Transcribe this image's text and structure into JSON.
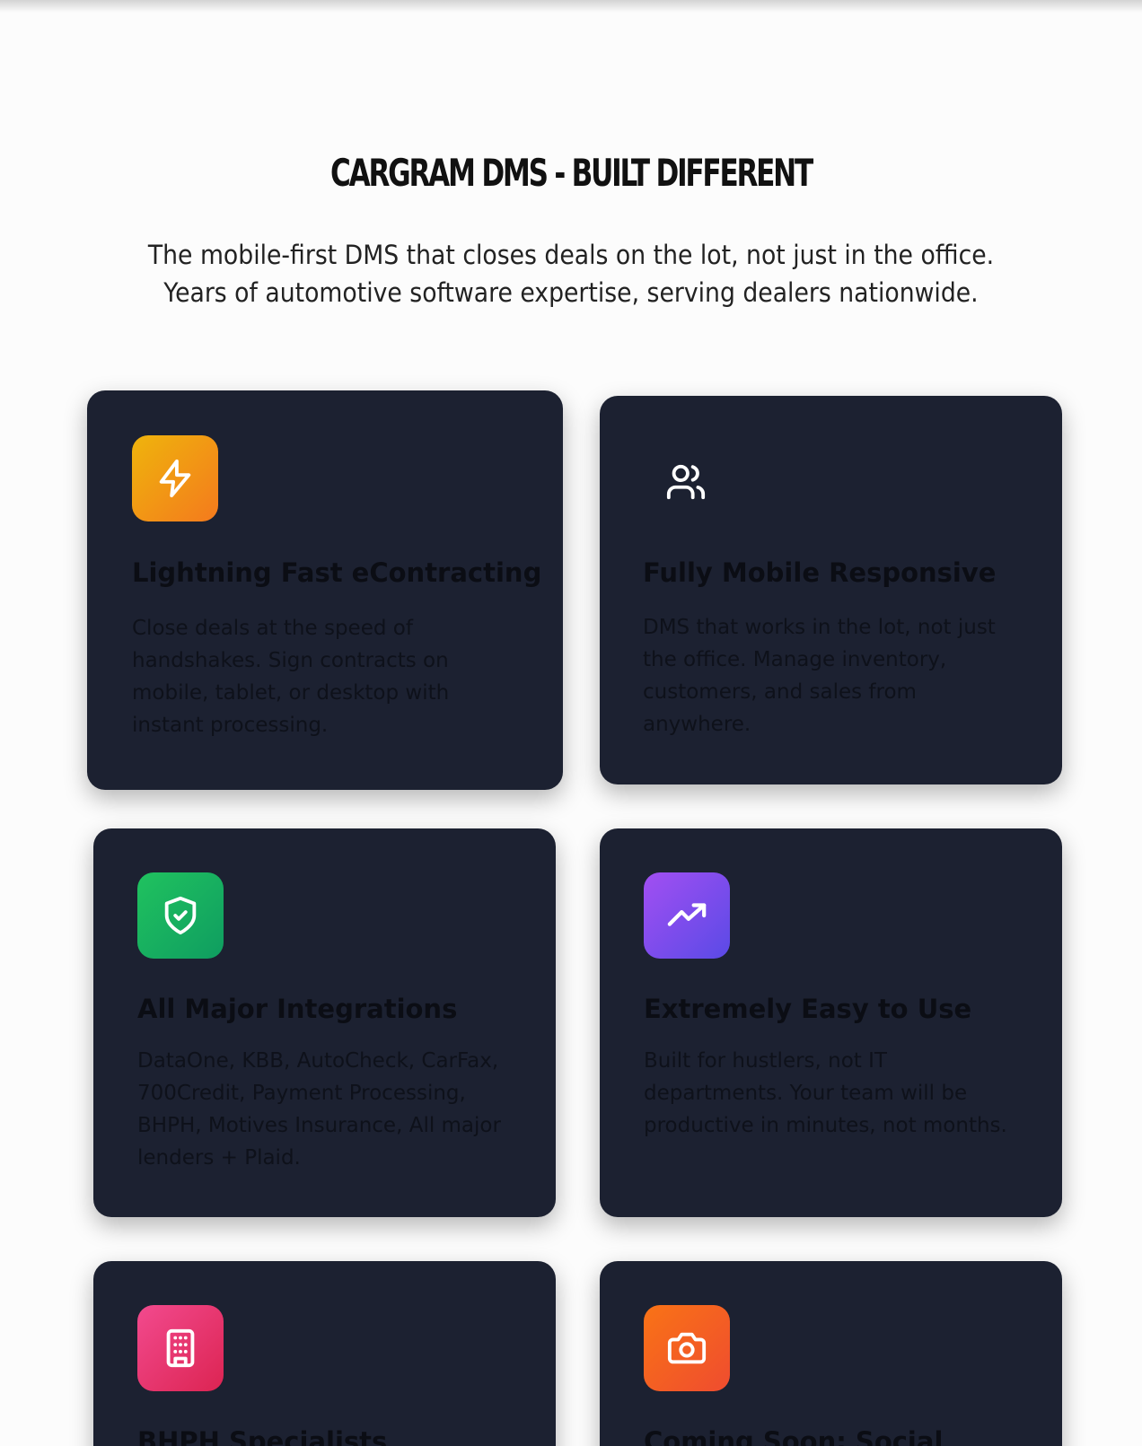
{
  "section": {
    "title": "CARGRAM DMS - BUILT DIFFERENT",
    "subtitle_line1": "The mobile-first DMS that closes deals on the lot, not just in the office.",
    "subtitle_line2": "Years of automotive software expertise, serving dealers nationwide."
  },
  "features": [
    {
      "icon": "lightning-icon",
      "title": "Lightning Fast eContracting",
      "text_lines": [
        "Close deals at the speed of",
        "handshakes. Sign contracts on",
        "mobile, tablet, or desktop with",
        "instant processing."
      ]
    },
    {
      "icon": "users-icon",
      "title": "Fully Mobile Responsive",
      "text_lines": [
        "DMS that works in the lot, not just",
        "the office. Manage inventory,",
        "customers, and sales from",
        "anywhere."
      ]
    },
    {
      "icon": "shield-check-icon",
      "title": "All Major Integrations",
      "text_lines": [
        "DataOne, KBB, AutoCheck, CarFax,",
        "700Credit, Payment Processing,",
        "BHPH, Motives Insurance, All major",
        "lenders + Plaid."
      ]
    },
    {
      "icon": "trending-up-icon",
      "title": "Extremely Easy to Use",
      "text_lines": [
        "Built for hustlers, not IT",
        "departments. Your team will be",
        "productive in minutes, not months."
      ]
    },
    {
      "icon": "building-icon",
      "title": "BHPH Specialists",
      "text_lines": []
    },
    {
      "icon": "camera-icon",
      "title": "Coming Soon: Social",
      "text_lines": []
    }
  ],
  "colors": {
    "card_background": "#1c2131",
    "page_background": "#fcfcfc",
    "lightning_gradient": [
      "#efb40c",
      "#f47a1d"
    ],
    "shield_gradient": [
      "#20c25f",
      "#0f9d60"
    ],
    "trending_gradient": [
      "#a24ff2",
      "#5a4ae6"
    ],
    "building_gradient": [
      "#f24a8e",
      "#dc2452"
    ],
    "camera_gradient": [
      "#f97316",
      "#ef4c2f"
    ]
  }
}
